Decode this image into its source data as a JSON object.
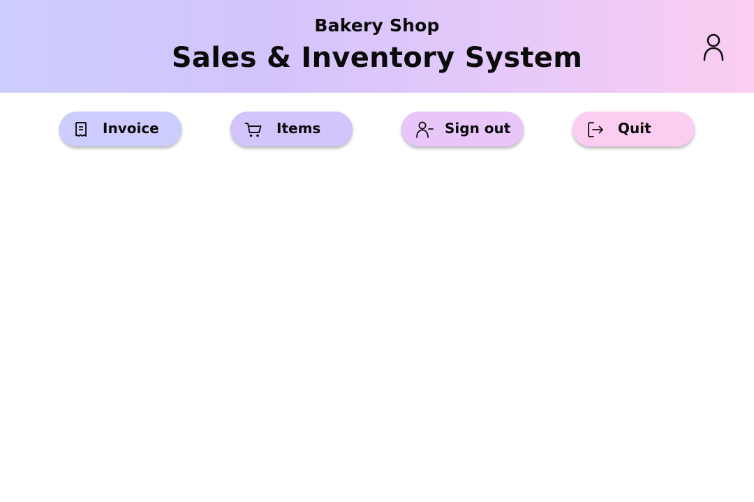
{
  "header": {
    "subtitle": "Bakery Shop",
    "title": "Sales & Inventory System",
    "gradient_colors": [
      "#cdcdfd",
      "#d3c4fb",
      "#e4c9fa",
      "#fbcdf1"
    ],
    "profile_icon": "user-icon"
  },
  "nav": {
    "buttons": [
      {
        "label": "Invoice",
        "icon": "receipt-icon",
        "color": "#cdcdfd"
      },
      {
        "label": "Items",
        "icon": "cart-icon",
        "color": "#d3c4fb"
      },
      {
        "label": "Sign out",
        "icon": "user-minus-icon",
        "color": "#e8c6f9"
      },
      {
        "label": "Quit",
        "icon": "exit-icon",
        "color": "#fbcdf1"
      }
    ]
  }
}
